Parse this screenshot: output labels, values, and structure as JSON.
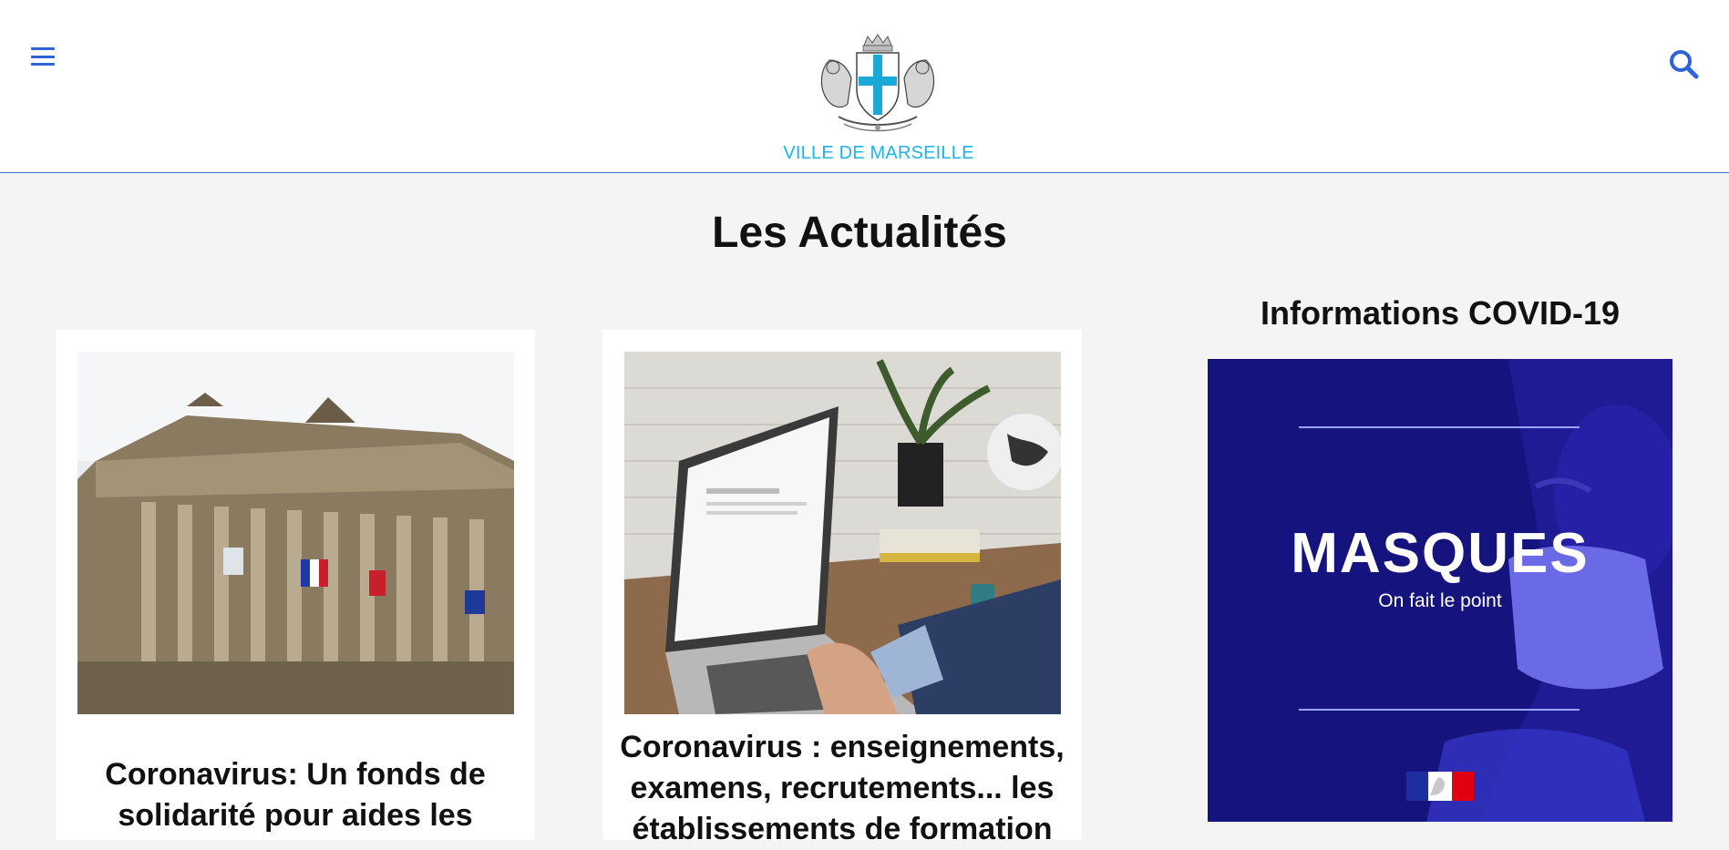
{
  "header": {
    "brand_name": "VILLE DE MARSEILLE",
    "menu_icon": "hamburger-icon",
    "search_icon": "search-icon",
    "accent_color": "#2f62d8",
    "brand_color": "#1fb3e8"
  },
  "main": {
    "title": "Les Actualités",
    "articles": [
      {
        "headline": "Coronavirus: Un fonds de solidarité pour aides les"
      },
      {
        "headline": "Coronavirus : enseignements, examens, recrutements... les établissements de formation"
      }
    ]
  },
  "sidebar": {
    "title": "Informations COVID-19",
    "banner": {
      "title": "MASQUES",
      "subtitle": "On fait le point",
      "background_color": "#15137d"
    }
  }
}
